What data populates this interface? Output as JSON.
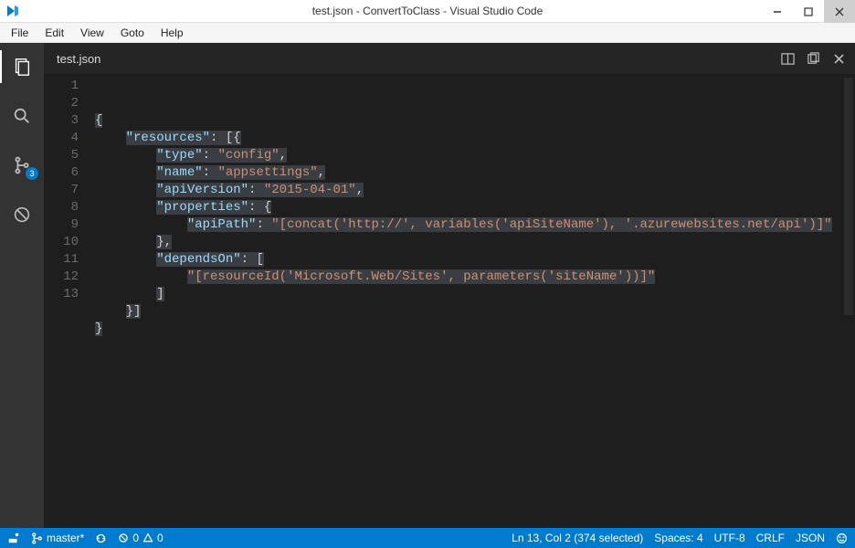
{
  "window": {
    "title": "test.json - ConvertToClass - Visual Studio Code"
  },
  "menu": {
    "items": [
      "File",
      "Edit",
      "View",
      "Goto",
      "Help"
    ]
  },
  "sidebar": {
    "git_badge": "3"
  },
  "tabs": {
    "active": "test.json"
  },
  "editor": {
    "line_numbers": [
      "1",
      "2",
      "3",
      "4",
      "5",
      "6",
      "7",
      "8",
      "9",
      "10",
      "11",
      "12",
      "13"
    ],
    "tokens": [
      [
        {
          "t": "{",
          "c": "punc",
          "sel": true
        }
      ],
      [
        {
          "t": "    ",
          "c": "punc"
        },
        {
          "t": "\"resources\"",
          "c": "key",
          "sel": true
        },
        {
          "t": ": [{",
          "c": "punc",
          "sel": true
        }
      ],
      [
        {
          "t": "        ",
          "c": "punc"
        },
        {
          "t": "\"type\"",
          "c": "key",
          "sel": true
        },
        {
          "t": ": ",
          "c": "punc",
          "sel": true
        },
        {
          "t": "\"config\"",
          "c": "str",
          "sel": true
        },
        {
          "t": ",",
          "c": "punc",
          "sel": true
        }
      ],
      [
        {
          "t": "        ",
          "c": "punc"
        },
        {
          "t": "\"name\"",
          "c": "key",
          "sel": true
        },
        {
          "t": ": ",
          "c": "punc",
          "sel": true
        },
        {
          "t": "\"appsettings\"",
          "c": "str",
          "sel": true
        },
        {
          "t": ",",
          "c": "punc",
          "sel": true
        }
      ],
      [
        {
          "t": "        ",
          "c": "punc"
        },
        {
          "t": "\"apiVersion\"",
          "c": "key",
          "sel": true
        },
        {
          "t": ": ",
          "c": "punc",
          "sel": true
        },
        {
          "t": "\"2015-04-01\"",
          "c": "str",
          "sel": true
        },
        {
          "t": ",",
          "c": "punc",
          "sel": true
        }
      ],
      [
        {
          "t": "        ",
          "c": "punc"
        },
        {
          "t": "\"properties\"",
          "c": "key",
          "sel": true
        },
        {
          "t": ": {",
          "c": "punc",
          "sel": true
        }
      ],
      [
        {
          "t": "            ",
          "c": "punc"
        },
        {
          "t": "\"apiPath\"",
          "c": "key",
          "sel": true
        },
        {
          "t": ": ",
          "c": "punc",
          "sel": true
        },
        {
          "t": "\"[concat('http://', variables('apiSiteName'), '.azurewebsites.net/api')]\"",
          "c": "str",
          "sel": true
        }
      ],
      [
        {
          "t": "        ",
          "c": "punc"
        },
        {
          "t": "},",
          "c": "punc",
          "sel": true
        }
      ],
      [
        {
          "t": "        ",
          "c": "punc"
        },
        {
          "t": "\"dependsOn\"",
          "c": "key",
          "sel": true
        },
        {
          "t": ": [",
          "c": "punc",
          "sel": true
        }
      ],
      [
        {
          "t": "            ",
          "c": "punc"
        },
        {
          "t": "\"[resourceId('Microsoft.Web/Sites', parameters('siteName'))]\"",
          "c": "str",
          "sel": true
        }
      ],
      [
        {
          "t": "        ",
          "c": "punc"
        },
        {
          "t": "]",
          "c": "punc",
          "sel": true
        }
      ],
      [
        {
          "t": "    ",
          "c": "punc"
        },
        {
          "t": "}]",
          "c": "punc",
          "sel": true
        }
      ],
      [
        {
          "t": "}",
          "c": "punc",
          "sel": true
        }
      ]
    ]
  },
  "status": {
    "branch": "master*",
    "errors": "0",
    "warnings": "0",
    "cursor": "Ln 13, Col 2 (374 selected)",
    "spaces": "Spaces: 4",
    "encoding": "UTF-8",
    "eol": "CRLF",
    "lang": "JSON"
  }
}
